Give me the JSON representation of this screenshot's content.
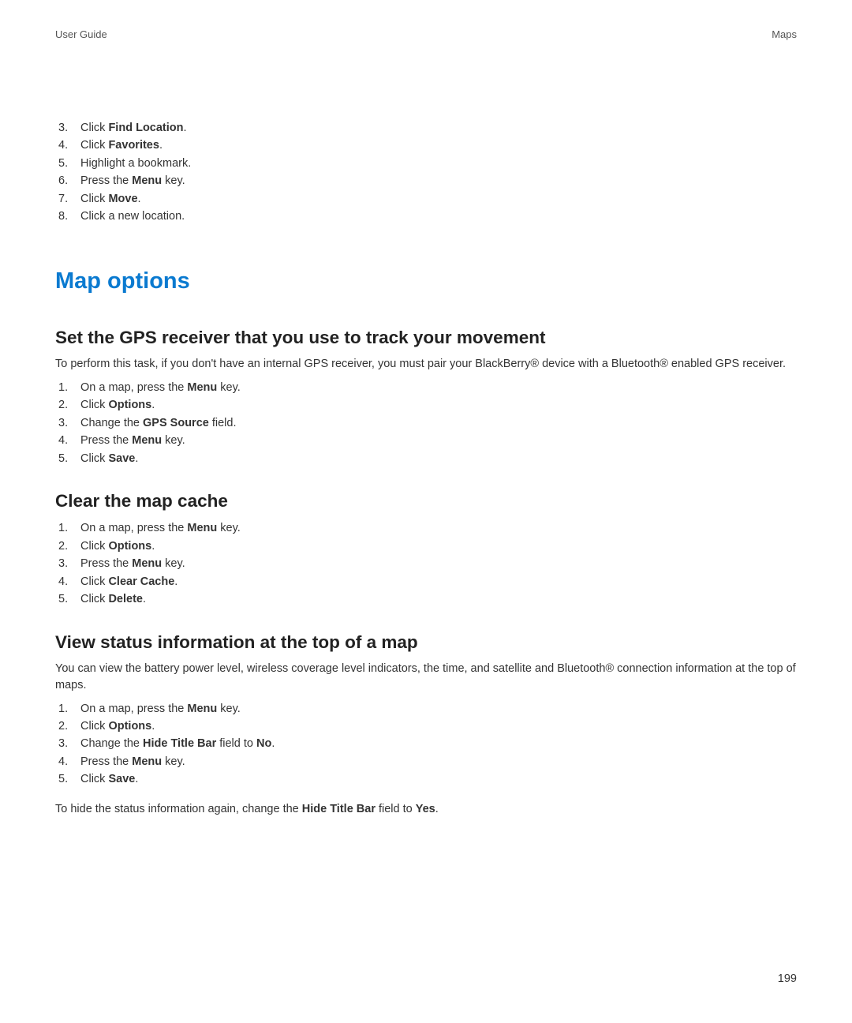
{
  "header": {
    "left": "User Guide",
    "right": "Maps"
  },
  "intro_list": [
    {
      "n": "3.",
      "pre": "Click ",
      "bold": "Find Location",
      "post": "."
    },
    {
      "n": "4.",
      "pre": "Click ",
      "bold": "Favorites",
      "post": "."
    },
    {
      "n": "5.",
      "pre": "Highlight a bookmark.",
      "bold": "",
      "post": ""
    },
    {
      "n": "6.",
      "pre": "Press the ",
      "bold": "Menu",
      "post": " key."
    },
    {
      "n": "7.",
      "pre": "Click ",
      "bold": "Move",
      "post": "."
    },
    {
      "n": "8.",
      "pre": "Click a new location.",
      "bold": "",
      "post": ""
    }
  ],
  "h1": "Map options",
  "sections": [
    {
      "h2": "Set the GPS receiver that you use to track your movement",
      "intro": "To perform this task, if you don't have an internal GPS receiver, you must pair your BlackBerry® device with a Bluetooth® enabled GPS receiver.",
      "steps": [
        {
          "n": "1.",
          "pre": "On a map, press the ",
          "bold": "Menu",
          "post": " key."
        },
        {
          "n": "2.",
          "pre": "Click ",
          "bold": "Options",
          "post": "."
        },
        {
          "n": "3.",
          "pre": "Change the ",
          "bold": "GPS Source",
          "post": " field."
        },
        {
          "n": "4.",
          "pre": "Press the ",
          "bold": "Menu",
          "post": " key."
        },
        {
          "n": "5.",
          "pre": "Click ",
          "bold": "Save",
          "post": "."
        }
      ],
      "trailing": ""
    },
    {
      "h2": "Clear the map cache",
      "intro": "",
      "steps": [
        {
          "n": "1.",
          "pre": "On a map, press the ",
          "bold": "Menu",
          "post": " key."
        },
        {
          "n": "2.",
          "pre": "Click ",
          "bold": "Options",
          "post": "."
        },
        {
          "n": "3.",
          "pre": "Press the ",
          "bold": "Menu",
          "post": " key."
        },
        {
          "n": "4.",
          "pre": "Click ",
          "bold": "Clear Cache",
          "post": "."
        },
        {
          "n": "5.",
          "pre": "Click ",
          "bold": "Delete",
          "post": "."
        }
      ],
      "trailing": ""
    },
    {
      "h2": "View status information at the top of a map",
      "intro": "You can view the battery power level, wireless coverage level indicators, the time, and satellite and Bluetooth® connection information at the top of maps.",
      "steps": [
        {
          "n": "1.",
          "pre": "On a map, press the ",
          "bold": "Menu",
          "post": " key."
        },
        {
          "n": "2.",
          "pre": "Click ",
          "bold": "Options",
          "post": "."
        },
        {
          "n": "3.",
          "pre": "Change the ",
          "bold": "Hide Title Bar",
          "post": " field to ",
          "bold2": "No",
          "post2": "."
        },
        {
          "n": "4.",
          "pre": "Press the ",
          "bold": "Menu",
          "post": " key."
        },
        {
          "n": "5.",
          "pre": "Click ",
          "bold": "Save",
          "post": "."
        }
      ],
      "trailing_pre": "To hide the status information again, change the ",
      "trailing_b1": "Hide Title Bar",
      "trailing_mid": " field to ",
      "trailing_b2": "Yes",
      "trailing_post": "."
    }
  ],
  "page_number": "199"
}
